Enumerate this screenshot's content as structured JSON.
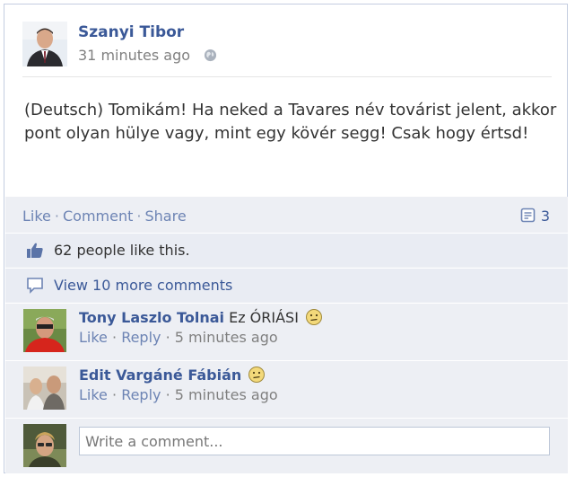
{
  "post": {
    "author": "Szanyi Tibor",
    "timestamp": "31 minutes ago",
    "privacy_icon": "globe-icon",
    "text": "(Deutsch) Tomikám! Ha neked a Tavares név továrist jelent, akkor pont olyan hülye vagy, mint egy kövér segg! Csak hogy értsd!"
  },
  "actions": {
    "like": "Like",
    "comment": "Comment",
    "share": "Share",
    "separator": "·",
    "comment_count": "3"
  },
  "likes": {
    "text": "62 people like this."
  },
  "view_more": {
    "text": "View 10 more comments"
  },
  "comments": [
    {
      "author": "Tony Laszlo Tolnai",
      "text": "Ez ÓRIÁSI",
      "like": "Like",
      "reply": "Reply",
      "separator": "·",
      "time": "5 minutes ago"
    },
    {
      "author": "Edit Vargáné Fábián",
      "text": "",
      "like": "Like",
      "reply": "Reply",
      "separator": "·",
      "time": "5 minutes ago"
    }
  ],
  "composer": {
    "placeholder": "Write a comment..."
  },
  "colors": {
    "link": "#3b5998",
    "muted_link": "#6d84b4",
    "feedback_bg": "#edeff4",
    "border": "#c4cde0"
  }
}
